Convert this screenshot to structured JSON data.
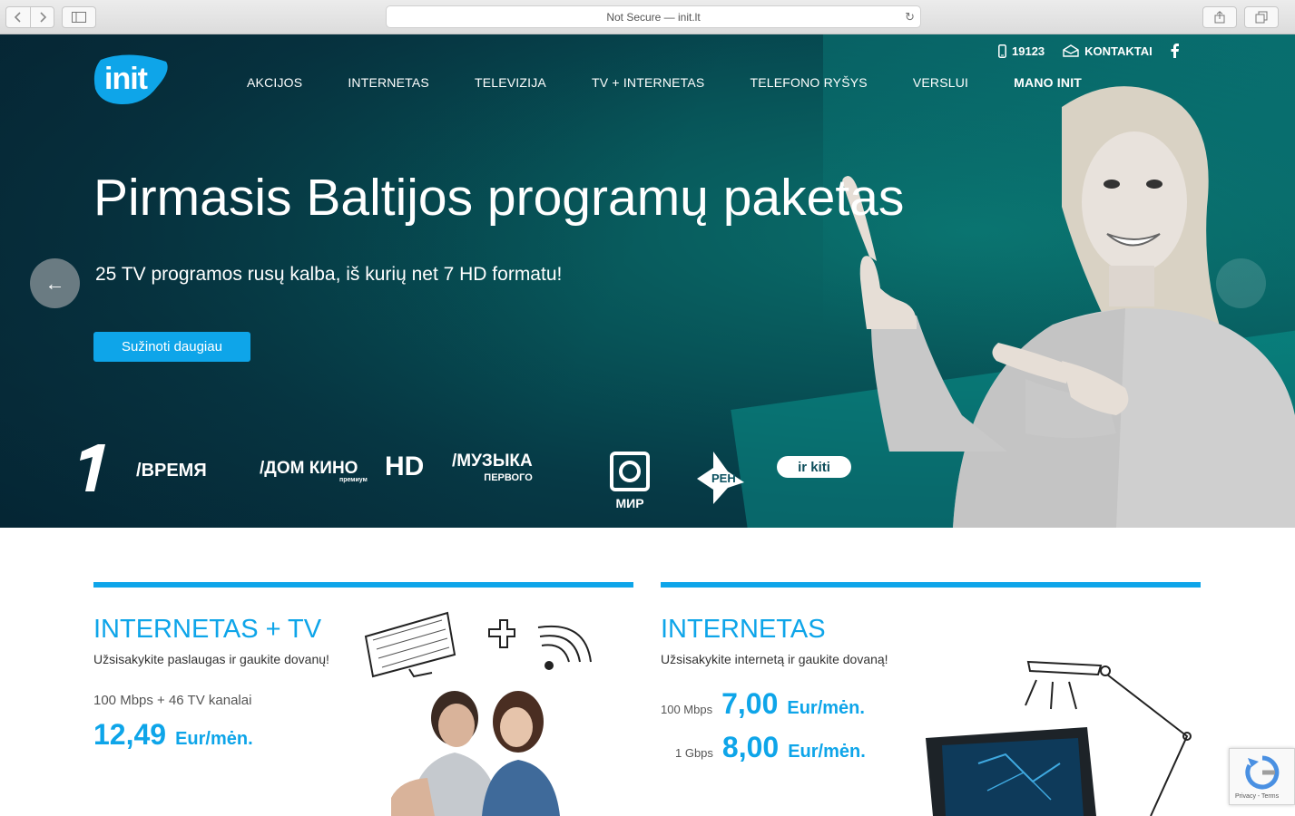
{
  "browser": {
    "address": "Not Secure — init.lt",
    "back_icon": "chevron-left-icon",
    "forward_icon": "chevron-right-icon",
    "sidebar_icon": "sidebar-icon",
    "share_icon": "share-icon",
    "tabs_icon": "tabs-icon"
  },
  "header": {
    "logo_text": "init",
    "phone": "19123",
    "contacts": "KONTAKTAI",
    "nav": [
      {
        "label": "AKCIJOS"
      },
      {
        "label": "INTERNETAS"
      },
      {
        "label": "TELEVIZIJA"
      },
      {
        "label": "TV + INTERNETAS"
      },
      {
        "label": "TELEFONO RYŠYS"
      },
      {
        "label": "VERSLUI"
      },
      {
        "label": "MANO INIT"
      }
    ]
  },
  "hero": {
    "title": "Pirmasis Baltijos programų paketas",
    "subtitle": "25 TV programos rusų kalba, iš kurių net 7 HD formatu!",
    "cta": "Sužinoti daugiau",
    "prev_arrow": "←",
    "channels": {
      "vremya": "ВРЕМЯ",
      "domkino": "ДОМ КИНО",
      "domkino_premium": "премиум",
      "domkino_hd": "HD",
      "muzyka": "МУЗЫКА",
      "muzyka_sub": "ПЕРВОГО",
      "ntv_sub": "МИР",
      "ren": "РЕН",
      "others": "ir kiti"
    }
  },
  "cards": {
    "left": {
      "title": "INTERNETAS + TV",
      "subtitle": "Užsisakykite paslaugas ir gaukite dovanų!",
      "spec": "100 Mbps + 46 TV kanalai",
      "price": "12,49",
      "unit": "Eur/mėn."
    },
    "right": {
      "title": "INTERNETAS",
      "subtitle": "Užsisakykite internetą ir gaukite dovaną!",
      "plans": [
        {
          "speed": "100 Mbps",
          "price": "7,00",
          "unit": "Eur/mėn."
        },
        {
          "speed": "1 Gbps",
          "price": "8,00",
          "unit": "Eur/mėn."
        }
      ]
    }
  },
  "recaptcha": {
    "text": "Privacy - Terms"
  },
  "colors": {
    "accent": "#0ea5e9",
    "hero_bg": "#063a46"
  }
}
